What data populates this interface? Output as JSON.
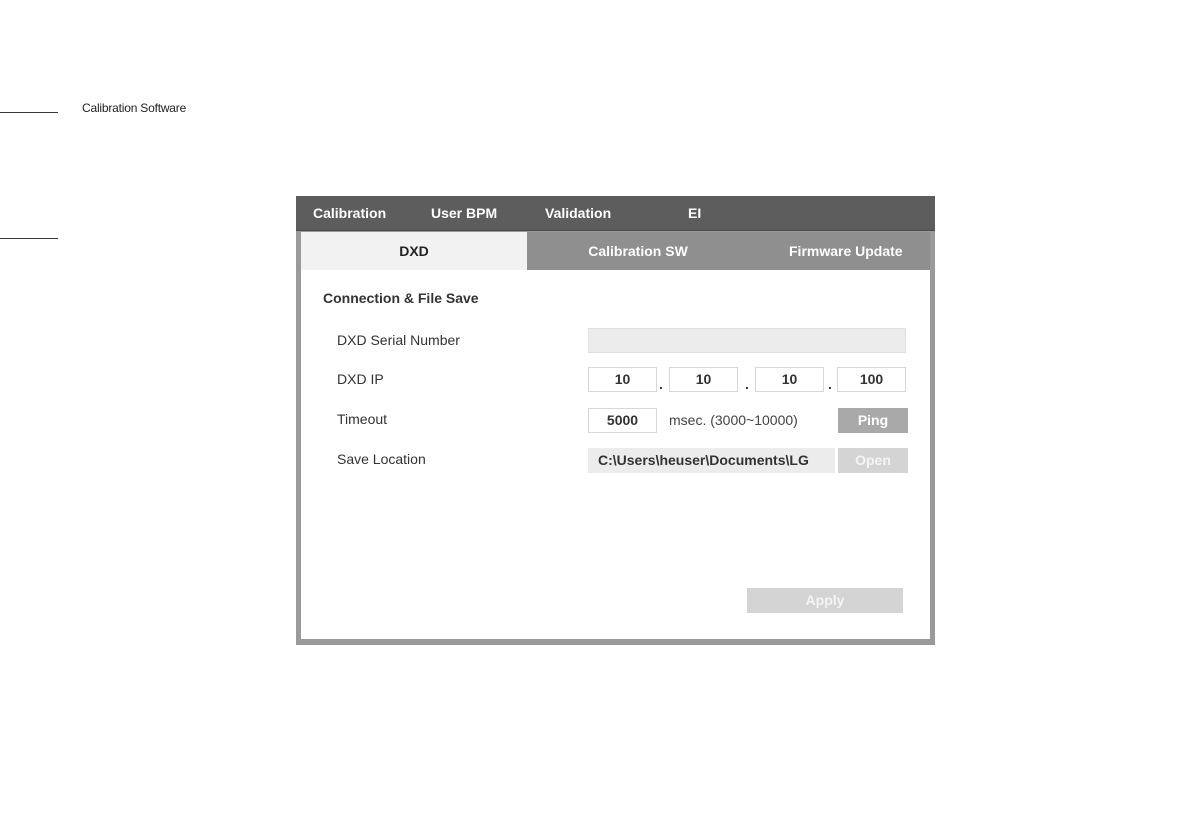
{
  "document": {
    "header_title": "Calibration Software"
  },
  "menubar": {
    "items": [
      "Calibration",
      "User BPM",
      "Validation",
      "EI"
    ]
  },
  "tabs": [
    {
      "label": "DXD",
      "active": true
    },
    {
      "label": "Calibration SW",
      "active": false
    },
    {
      "label": "Firmware Update",
      "active": false
    }
  ],
  "panel": {
    "section_title": "Connection & File Save",
    "serial_label": "DXD Serial Number",
    "serial_value": "",
    "ip_label": "DXD IP",
    "ip_octets": [
      "10",
      "10",
      "10",
      "100"
    ],
    "ip_separator": ".",
    "timeout_label": "Timeout",
    "timeout_value": "5000",
    "timeout_hint": "msec. (3000~10000)",
    "ping_label": "Ping",
    "save_label": "Save Location",
    "save_path": "C:\\Users\\heuser\\Documents\\LG",
    "open_label": "Open",
    "apply_label": "Apply"
  },
  "colors": {
    "menubar_bg": "#5d5d5d",
    "tabbar_bg": "#8f8f8f",
    "active_tab_bg": "#f2f2f2",
    "button_bg": "#a9a9a9",
    "disabled_button_bg": "#d4d4d4"
  }
}
